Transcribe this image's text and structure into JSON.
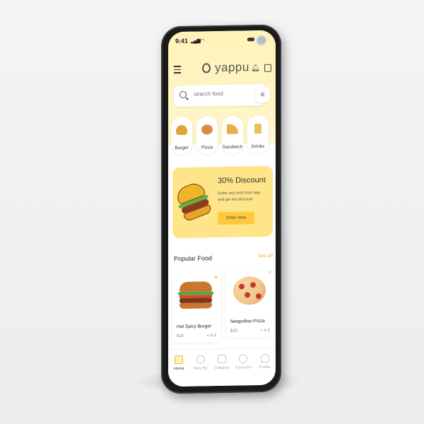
{
  "status": {
    "time": "9:41"
  },
  "header": {
    "logo_text": "yappu"
  },
  "search": {
    "placeholder": "search food"
  },
  "categories": [
    {
      "label": "Burger",
      "color": "#e3a23a"
    },
    {
      "label": "Pizza",
      "color": "#d98c4a"
    },
    {
      "label": "Sandwich",
      "color": "#e9b04a"
    },
    {
      "label": "Drinks",
      "color": "#e8c15a"
    }
  ],
  "promo": {
    "title": "30% Discount",
    "description": "Order any food from app and get the discount",
    "button": "Order Now"
  },
  "popular": {
    "title": "Popular Food",
    "see_all": "See all",
    "items": [
      {
        "name": "Hot Spicy Burger",
        "price": "$14",
        "rating": "4.3"
      },
      {
        "name": "Neapolitan Pizza",
        "price": "$20",
        "rating": "4.3"
      }
    ]
  },
  "nav": [
    {
      "label": "Home"
    },
    {
      "label": "Near By"
    },
    {
      "label": "Category"
    },
    {
      "label": "Favourite"
    },
    {
      "label": "Profile"
    }
  ],
  "colors": {
    "accent": "#ffc93c",
    "promo_bg": "#ffe58a",
    "header_bg": "#fff3b8"
  }
}
